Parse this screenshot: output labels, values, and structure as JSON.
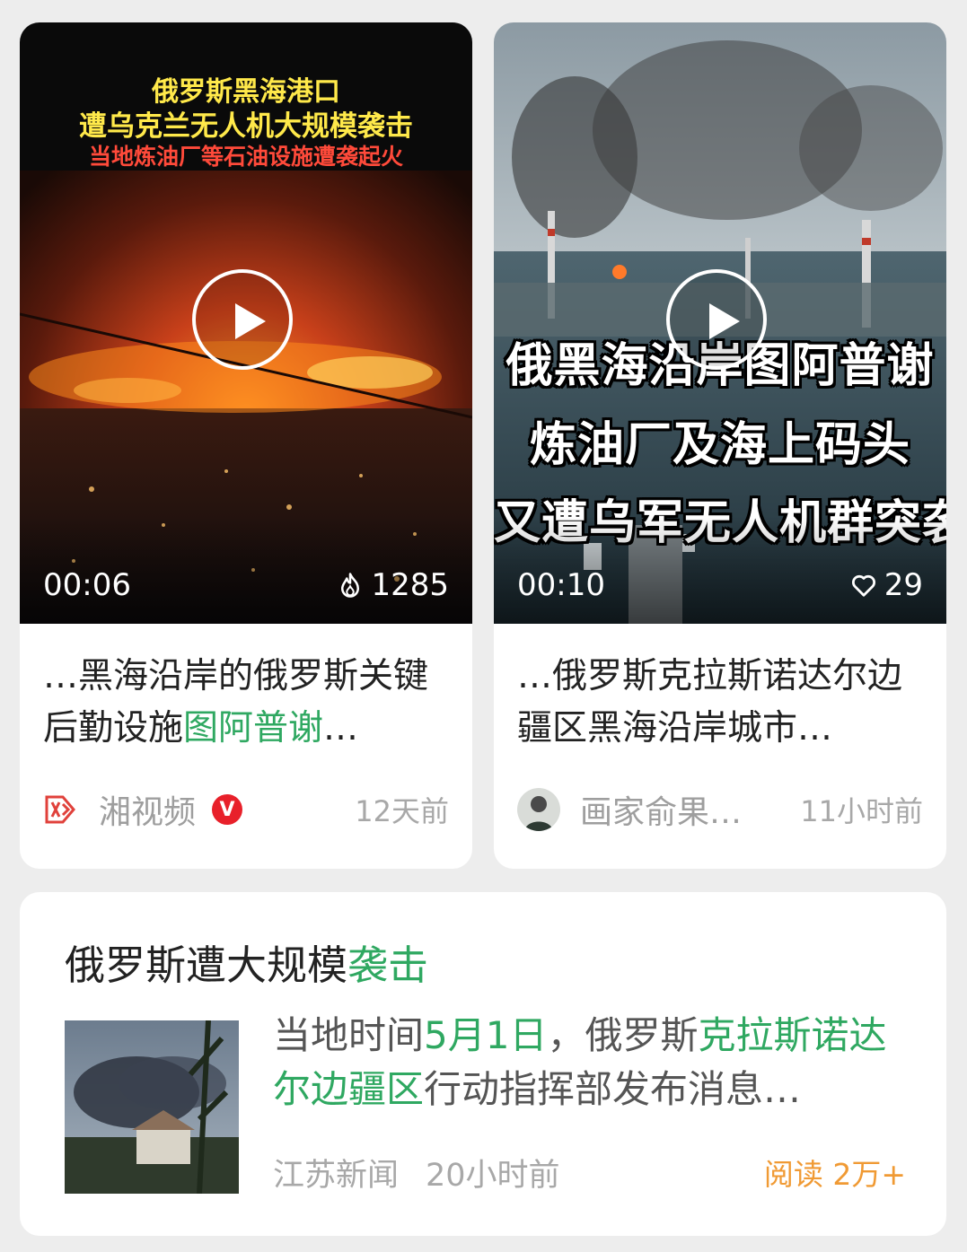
{
  "cards": [
    {
      "caption_lines": [
        "俄罗斯黑海港口",
        "遭乌克兰无人机大规模袭击",
        "当地炼油厂等石油设施遭袭起火"
      ],
      "duration": "00:06",
      "count": "1285",
      "count_icon": "flame-icon",
      "title_prefix": "…黑海沿岸的俄罗斯关键后勤设施",
      "title_highlight": "图阿普谢",
      "title_suffix": "…",
      "source": "湘视频",
      "verified_badge": "V",
      "time": "12天前"
    },
    {
      "overlay_lines": [
        "俄黑海沿岸图阿普谢",
        "炼油厂及海上码头",
        "又遭乌军无人机群突袭"
      ],
      "duration": "00:10",
      "count": "29",
      "count_icon": "heart-icon",
      "title": "…俄罗斯克拉斯诺达尔边疆区黑海沿岸城市…",
      "source": "画家俞果…",
      "time": "11小时前"
    }
  ],
  "article": {
    "title_prefix": "俄罗斯遭大规模",
    "title_highlight": "袭击",
    "summary_1": "当地时间",
    "summary_hl_1": "5月1日",
    "summary_2": "，俄罗斯",
    "summary_hl_2": "克拉斯诺达尔边疆区",
    "summary_3": "行动指挥部发布消息…",
    "source": "江苏新闻",
    "time": "20小时前",
    "reads": "阅读 2万+"
  },
  "colors": {
    "highlight": "#2fa861",
    "reads": "#f09a34",
    "badge": "#e8202a"
  }
}
